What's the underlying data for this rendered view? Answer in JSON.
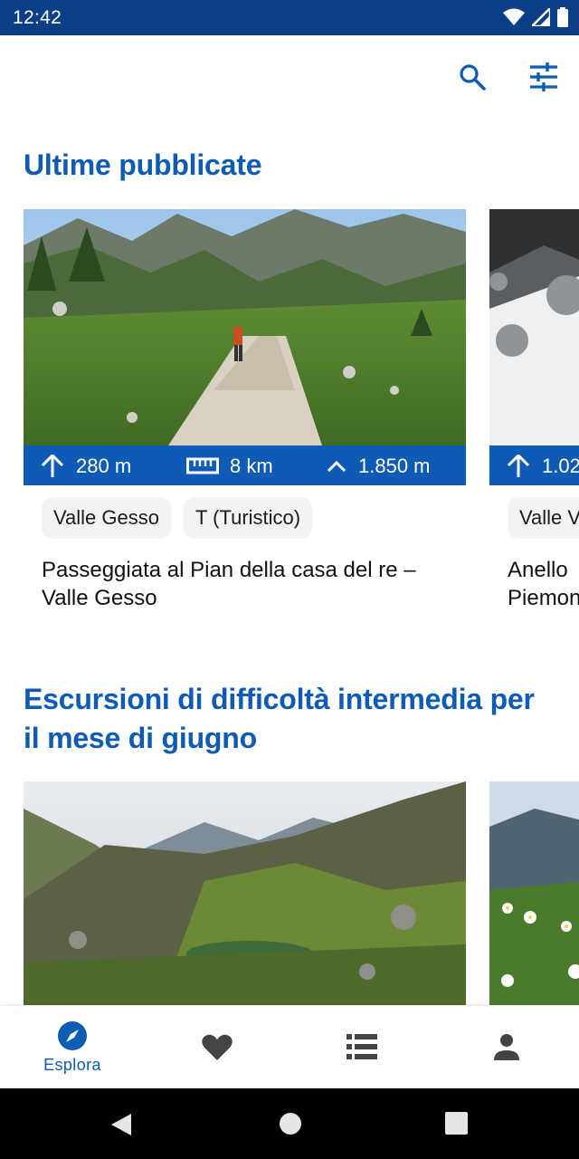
{
  "status_bar": {
    "time": "12:42"
  },
  "colors": {
    "primary": "#0d5bb5",
    "status_bar": "#0a3f86",
    "chip_bg": "#f2f3f5"
  },
  "appbar": {
    "icons": [
      "search-icon",
      "filter-sliders-icon"
    ]
  },
  "sections": [
    {
      "title": "Ultime pubblicate",
      "cards": [
        {
          "stats": {
            "elevation": "280 m",
            "distance": "8 km",
            "altitude": "1.850 m"
          },
          "chips": [
            "Valle Gesso",
            "T (Turistico)"
          ],
          "title": "Passeggiata al Pian della casa del re – Valle Gesso"
        },
        {
          "stats": {
            "elevation": "1.02"
          },
          "chips": [
            "Valle V"
          ],
          "title_lines": [
            "Anello",
            "Piemon"
          ]
        }
      ]
    },
    {
      "title": "Escursioni di difficoltà intermedia per il mese di giugno",
      "cards": []
    }
  ],
  "bottom_nav": {
    "items": [
      {
        "icon": "compass-icon",
        "label": "Esplora",
        "active": true
      },
      {
        "icon": "heart-icon"
      },
      {
        "icon": "list-icon"
      },
      {
        "icon": "person-icon"
      }
    ]
  },
  "system_nav": {
    "icons": [
      "back-icon",
      "home-icon",
      "recents-icon"
    ]
  }
}
